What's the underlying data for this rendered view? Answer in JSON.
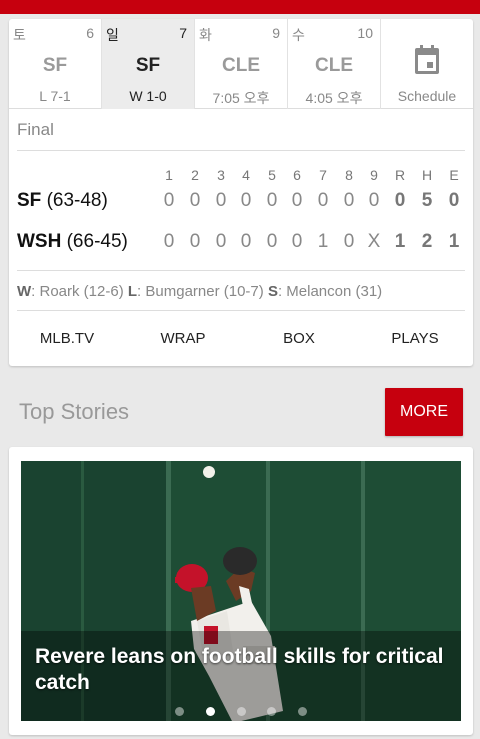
{
  "colors": {
    "accent": "#c6000e"
  },
  "days": [
    {
      "dow": "토",
      "num": "6",
      "team": "SF",
      "result": "L 7-1",
      "selected": false
    },
    {
      "dow": "일",
      "num": "7",
      "team": "SF",
      "result": "W 1-0",
      "selected": true
    },
    {
      "dow": "화",
      "num": "9",
      "team": "CLE",
      "result": "7:05 오후",
      "selected": false
    },
    {
      "dow": "수",
      "num": "10",
      "team": "CLE",
      "result": "4:05 오후",
      "selected": false
    }
  ],
  "schedule": {
    "label": "Schedule",
    "icon": "calendar-icon"
  },
  "game": {
    "status": "Final",
    "columns": [
      "1",
      "2",
      "3",
      "4",
      "5",
      "6",
      "7",
      "8",
      "9",
      "R",
      "H",
      "E"
    ],
    "teams": [
      {
        "abbr": "SF",
        "record": "(63-48)",
        "cells": [
          "0",
          "0",
          "0",
          "0",
          "0",
          "0",
          "0",
          "0",
          "0",
          "0",
          "5",
          "0"
        ]
      },
      {
        "abbr": "WSH",
        "record": "(66-45)",
        "cells": [
          "0",
          "0",
          "0",
          "0",
          "0",
          "0",
          "1",
          "0",
          "X",
          "1",
          "2",
          "1"
        ]
      }
    ],
    "pitchers": {
      "w_label": "W",
      "w_text": ": Roark (12-6) ",
      "l_label": "L",
      "l_text": ": Bumgarner (10-7) ",
      "s_label": "S",
      "s_text": ": Melancon (31)"
    },
    "links": [
      "MLB.TV",
      "WRAP",
      "BOX",
      "PLAYS"
    ]
  },
  "stories": {
    "title": "Top Stories",
    "more_label": "MORE",
    "headline": "Revere leans on football skills for critical catch",
    "dot_count": 5,
    "active_dot": 1
  }
}
